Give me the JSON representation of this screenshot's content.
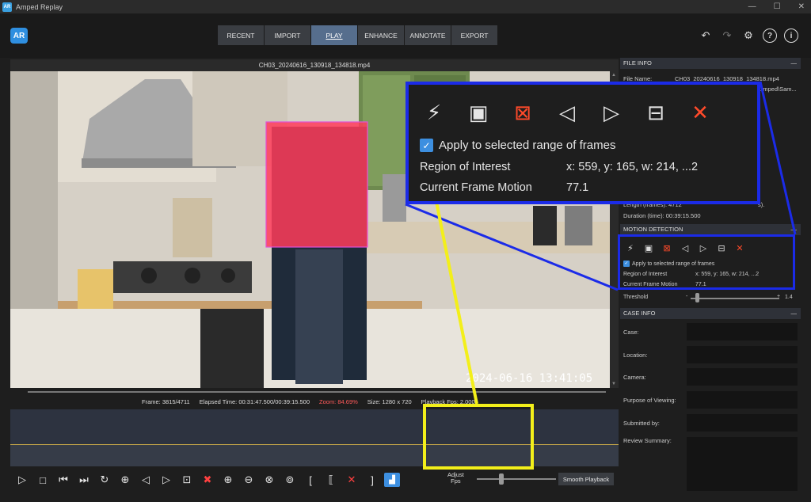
{
  "window": {
    "title": "Amped Replay",
    "controls": [
      "—",
      "☐",
      "✕"
    ]
  },
  "app": {
    "logo_text": "AR"
  },
  "nav": {
    "tabs": [
      {
        "label": "RECENT"
      },
      {
        "label": "IMPORT"
      },
      {
        "label": "PLAY"
      },
      {
        "label": "ENHANCE"
      },
      {
        "label": "ANNOTATE"
      },
      {
        "label": "EXPORT"
      }
    ]
  },
  "header_icons": {
    "undo": "↶",
    "redo": "↷",
    "settings": "⚙",
    "help": "?",
    "info": "i"
  },
  "video": {
    "filename": "CH03_20240616_130918_134818.mp4",
    "timestamp": "2024-06-16 13:41:05"
  },
  "status": {
    "help": "?",
    "frame": "Frame: 3815/4711",
    "elapsed": "Elapsed Time: 00:31:47.500/00:39:15.500",
    "zoom": "Zoom: 84.69%",
    "size": "Size: 1280 x 720",
    "playback": "Playback Fps: 2.000"
  },
  "controls": {
    "adjust_fps_label": "Adjust\nFps",
    "smooth_playback": "Smooth Playback"
  },
  "file_info": {
    "header": "FILE INFO",
    "collapse": "—",
    "rows": [
      {
        "label": "File Name:",
        "value": "CH03_20240616_130918_134818.mp4"
      },
      {
        "label": "",
        "value": "...mped\\Sam..."
      }
    ],
    "length_frames": "Length (frames): 4712",
    "length_suffix": "s).",
    "duration": "Duration (time):  00:39:15.500"
  },
  "motion_detection": {
    "header": "MOTION DETECTION",
    "collapse": "—",
    "apply_label": "Apply to selected range of frames",
    "roi_label": "Region of Interest",
    "roi_value": "x: 559,  y: 165,  w: 214,  ...2",
    "motion_label": "Current Frame Motion",
    "motion_value": "77.1",
    "threshold_label": "Threshold",
    "threshold_minus": "-",
    "threshold_plus": "+",
    "threshold_value": "1.4"
  },
  "case_info": {
    "header": "CASE INFO",
    "collapse": "—",
    "fields": [
      {
        "label": "Case:"
      },
      {
        "label": "Location:"
      },
      {
        "label": "Camera:"
      },
      {
        "label": "Purpose of Viewing:"
      },
      {
        "label": "Submitted by:"
      },
      {
        "label": "Review Summary:"
      }
    ]
  },
  "colors": {
    "accent": "#3d8fe0",
    "callout_blue": "#1b2be8",
    "callout_yellow": "#f3ef1a",
    "zoom_text": "#ff5a5a",
    "motion_overlay": "#ff3c5a"
  }
}
